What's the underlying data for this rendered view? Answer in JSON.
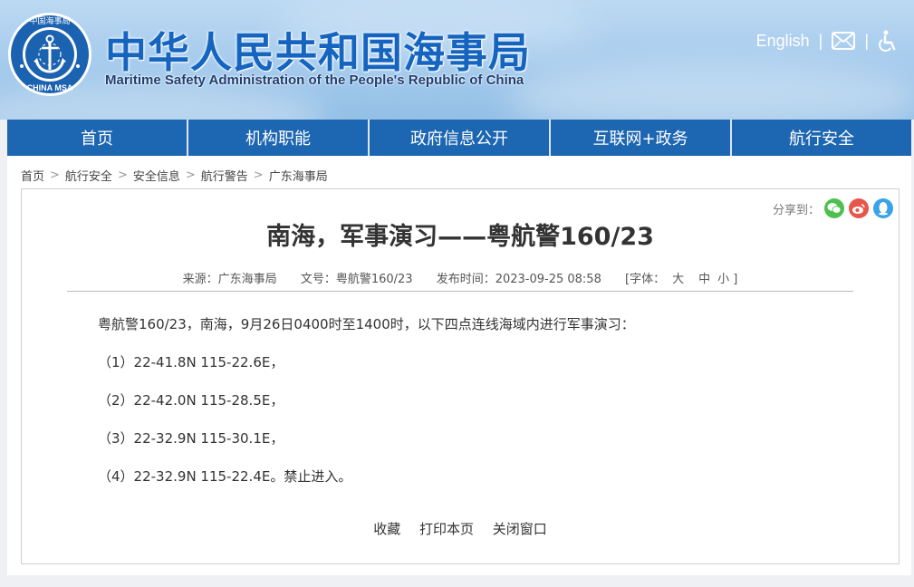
{
  "header": {
    "title_cn": "中华人民共和国海事局",
    "title_en": "Maritime Safety Administration of the People's Republic of China",
    "logo_text_top": "中国海事局",
    "logo_text_bottom": "CHINA MSA",
    "english_link": "English",
    "separator": "|",
    "mail_icon": "mail-icon",
    "accessibility_icon": "accessibility-icon"
  },
  "nav": {
    "items": [
      "首页",
      "机构职能",
      "政府信息公开",
      "互联网+政务",
      "航行安全"
    ]
  },
  "breadcrumb": {
    "items": [
      "首页",
      "航行安全",
      "安全信息",
      "航行警告",
      "广东海事局"
    ],
    "separator": ">"
  },
  "share": {
    "label": "分享到：",
    "icons": [
      "wechat-icon",
      "weibo-icon",
      "qq-icon"
    ]
  },
  "article": {
    "title": "南海，军事演习——粤航警160/23",
    "source": "来源：广东海事局",
    "doc_no": "文号：粤航警160/23",
    "published": "发布时间：2023-09-25 08:58",
    "font_size": "[字体：",
    "font_large": "大",
    "font_medium": "中",
    "font_small": "小 ]",
    "paragraphs": [
      "粤航警160/23，南海，9月26日0400时至1400时，以下四点连线海域内进行军事演习：",
      "（1）22-41.8N 115-22.6E，",
      "（2）22-42.0N 115-28.5E，",
      "（3）22-32.9N 115-30.1E，",
      "（4）22-32.9N 115-22.4E。禁止进入。"
    ],
    "actions": [
      "收藏",
      "打印本页",
      "关闭窗口"
    ]
  },
  "colors": {
    "nav_bg": "#1d66b1",
    "title_blue": "#1565c0",
    "page_bg": "#eef0f3"
  }
}
